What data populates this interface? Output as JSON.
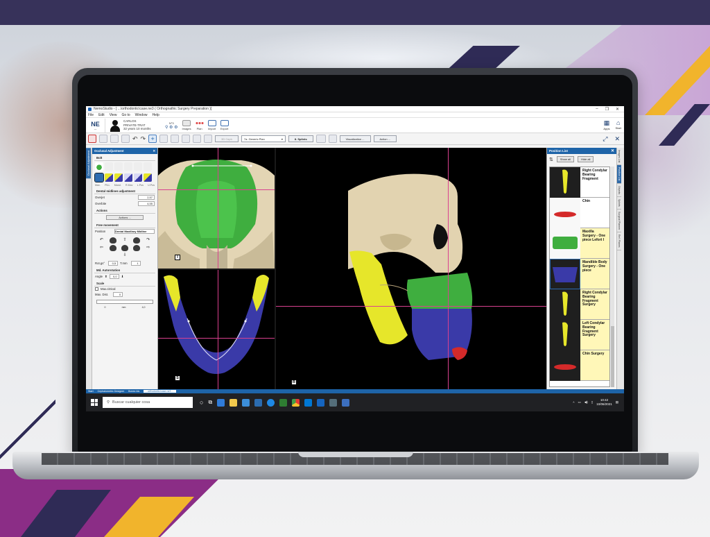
{
  "window": {
    "title": "NemoStudio - [ ...\\orthodontic\\case.ne3 ( Orthognathic Surgery Preparation )]",
    "controls": [
      "–",
      "❐",
      "✕"
    ]
  },
  "menu": [
    "File",
    "Edit",
    "View",
    "Go to",
    "Window",
    "Help"
  ],
  "ribbon": {
    "logo": "NE",
    "patient_name": "CARLOS",
    "patient_line2": "PRIVATE-TRAT",
    "patient_age": "32 years 10 months",
    "case_id": "N°3",
    "groups": [
      {
        "label": "Images",
        "color": "#e8e8e8"
      },
      {
        "label": "Plan",
        "color": "#e05050"
      },
      {
        "label": "Import",
        "color": "#3d6fb0"
      },
      {
        "label": "Export",
        "color": "#3d6fb0"
      }
    ],
    "right_buttons": [
      {
        "label": "Apps",
        "icon": "apps-icon"
      },
      {
        "label": "Start",
        "icon": "home-icon"
      }
    ]
  },
  "toolbar": {
    "ceph_btn": "3D Ceph",
    "plan_select": "7a. Generic Plan",
    "splints_btn": "8. Splints",
    "visualization_btn": "Visualization ...",
    "actions_btn": "Action ..."
  },
  "left_tab": "Occlusal Adjustment",
  "left_panel": {
    "title": "Occlusal Adjustment",
    "section_bolt": "Bolt",
    "tool_labels": [
      "Max.",
      "PILL",
      "Mand.",
      "R.Mov",
      "L.Pos",
      "U.Pos"
    ],
    "dental_midline": "Dental midlines adjustment",
    "overjet_label": "Overjet",
    "overjet_value": "2,57",
    "overbite_label": "Overbite",
    "overbite_value": "4,55",
    "actions_title": "Actions",
    "actions_btn": "Actions ...",
    "free_movement": "Free movement",
    "position_label": "Position",
    "position_value": "Dental Maxillary Midline",
    "rotation_label": "Rot.gs°",
    "rotation_value": "0,5",
    "translation_label": "T.mm",
    "translation_value": "1",
    "autorotation_title": "Md. Autorotation",
    "angle_label": "Angle",
    "angle_value": "0,0",
    "scale_title": "Scale",
    "max_checkbox": "Max.citrical",
    "max_dist_label": "Max. Dist.",
    "max_dist_value": "0",
    "scale_ticks": [
      "0",
      "mm",
      "4,0"
    ]
  },
  "viewports": {
    "top_label": "I",
    "bottom_label": "S",
    "main_label": "R"
  },
  "right_panel": {
    "title": "Position List",
    "show_all": "Show all",
    "hide_all": "Hide all",
    "items": [
      {
        "label": "Right Condylar Bearing Fragment",
        "thumb": "yellow-condyle",
        "highlight": false
      },
      {
        "label": "Chin",
        "thumb": "red-chin",
        "highlight": false
      },
      {
        "label": "Maxilla Surgery - One piece Lefort I",
        "thumb": "green-maxilla",
        "highlight": true
      },
      {
        "label": "Mandible Body Surgery - One piece",
        "thumb": "blue-mandible",
        "highlight": true
      },
      {
        "label": "Right Condylar Bearing Fragment Surgery",
        "thumb": "yellow-condyle",
        "highlight": true
      },
      {
        "label": "Left Condylar Bearing Fragment Surgery",
        "thumb": "yellow-condyle",
        "highlight": true
      },
      {
        "label": "Chin Surgery",
        "thumb": "red-chin",
        "highlight": true
      }
    ],
    "vertical_tabs": [
      "Images List",
      "Position List",
      "Objects",
      "Splints",
      "Surgical Planner",
      "Ref. Planes"
    ]
  },
  "statusbar": [
    "Start",
    "Cephalometric Designer",
    "Bones Ids",
    "...orthodontic\\case.ne3 ..."
  ],
  "taskbar": {
    "search_placeholder": "Buscar cualquier cosa",
    "time": "10:42",
    "date": "10/06/2021"
  },
  "colors": {
    "accent": "#1e64a8",
    "maxilla": "#3fae3f",
    "mandible": "#3a3aa8",
    "condyle": "#e6e62a",
    "chin": "#d42a2a",
    "skull": "#e0d2b0",
    "crosshair": "#d9418f",
    "list_highlight": "#fff7b8"
  }
}
